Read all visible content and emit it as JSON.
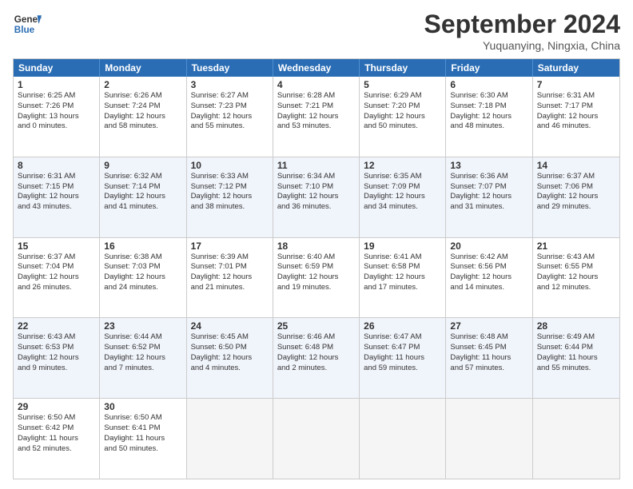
{
  "logo": {
    "line1": "General",
    "line2": "Blue"
  },
  "title": "September 2024",
  "subtitle": "Yuquanying, Ningxia, China",
  "days": [
    "Sunday",
    "Monday",
    "Tuesday",
    "Wednesday",
    "Thursday",
    "Friday",
    "Saturday"
  ],
  "weeks": [
    [
      {
        "day": "1",
        "sunrise": "Sunrise: 6:25 AM",
        "sunset": "Sunset: 7:26 PM",
        "daylight": "Daylight: 13 hours",
        "minutes": "and 0 minutes."
      },
      {
        "day": "2",
        "sunrise": "Sunrise: 6:26 AM",
        "sunset": "Sunset: 7:24 PM",
        "daylight": "Daylight: 12 hours",
        "minutes": "and 58 minutes."
      },
      {
        "day": "3",
        "sunrise": "Sunrise: 6:27 AM",
        "sunset": "Sunset: 7:23 PM",
        "daylight": "Daylight: 12 hours",
        "minutes": "and 55 minutes."
      },
      {
        "day": "4",
        "sunrise": "Sunrise: 6:28 AM",
        "sunset": "Sunset: 7:21 PM",
        "daylight": "Daylight: 12 hours",
        "minutes": "and 53 minutes."
      },
      {
        "day": "5",
        "sunrise": "Sunrise: 6:29 AM",
        "sunset": "Sunset: 7:20 PM",
        "daylight": "Daylight: 12 hours",
        "minutes": "and 50 minutes."
      },
      {
        "day": "6",
        "sunrise": "Sunrise: 6:30 AM",
        "sunset": "Sunset: 7:18 PM",
        "daylight": "Daylight: 12 hours",
        "minutes": "and 48 minutes."
      },
      {
        "day": "7",
        "sunrise": "Sunrise: 6:31 AM",
        "sunset": "Sunset: 7:17 PM",
        "daylight": "Daylight: 12 hours",
        "minutes": "and 46 minutes."
      }
    ],
    [
      {
        "day": "8",
        "sunrise": "Sunrise: 6:31 AM",
        "sunset": "Sunset: 7:15 PM",
        "daylight": "Daylight: 12 hours",
        "minutes": "and 43 minutes."
      },
      {
        "day": "9",
        "sunrise": "Sunrise: 6:32 AM",
        "sunset": "Sunset: 7:14 PM",
        "daylight": "Daylight: 12 hours",
        "minutes": "and 41 minutes."
      },
      {
        "day": "10",
        "sunrise": "Sunrise: 6:33 AM",
        "sunset": "Sunset: 7:12 PM",
        "daylight": "Daylight: 12 hours",
        "minutes": "and 38 minutes."
      },
      {
        "day": "11",
        "sunrise": "Sunrise: 6:34 AM",
        "sunset": "Sunset: 7:10 PM",
        "daylight": "Daylight: 12 hours",
        "minutes": "and 36 minutes."
      },
      {
        "day": "12",
        "sunrise": "Sunrise: 6:35 AM",
        "sunset": "Sunset: 7:09 PM",
        "daylight": "Daylight: 12 hours",
        "minutes": "and 34 minutes."
      },
      {
        "day": "13",
        "sunrise": "Sunrise: 6:36 AM",
        "sunset": "Sunset: 7:07 PM",
        "daylight": "Daylight: 12 hours",
        "minutes": "and 31 minutes."
      },
      {
        "day": "14",
        "sunrise": "Sunrise: 6:37 AM",
        "sunset": "Sunset: 7:06 PM",
        "daylight": "Daylight: 12 hours",
        "minutes": "and 29 minutes."
      }
    ],
    [
      {
        "day": "15",
        "sunrise": "Sunrise: 6:37 AM",
        "sunset": "Sunset: 7:04 PM",
        "daylight": "Daylight: 12 hours",
        "minutes": "and 26 minutes."
      },
      {
        "day": "16",
        "sunrise": "Sunrise: 6:38 AM",
        "sunset": "Sunset: 7:03 PM",
        "daylight": "Daylight: 12 hours",
        "minutes": "and 24 minutes."
      },
      {
        "day": "17",
        "sunrise": "Sunrise: 6:39 AM",
        "sunset": "Sunset: 7:01 PM",
        "daylight": "Daylight: 12 hours",
        "minutes": "and 21 minutes."
      },
      {
        "day": "18",
        "sunrise": "Sunrise: 6:40 AM",
        "sunset": "Sunset: 6:59 PM",
        "daylight": "Daylight: 12 hours",
        "minutes": "and 19 minutes."
      },
      {
        "day": "19",
        "sunrise": "Sunrise: 6:41 AM",
        "sunset": "Sunset: 6:58 PM",
        "daylight": "Daylight: 12 hours",
        "minutes": "and 17 minutes."
      },
      {
        "day": "20",
        "sunrise": "Sunrise: 6:42 AM",
        "sunset": "Sunset: 6:56 PM",
        "daylight": "Daylight: 12 hours",
        "minutes": "and 14 minutes."
      },
      {
        "day": "21",
        "sunrise": "Sunrise: 6:43 AM",
        "sunset": "Sunset: 6:55 PM",
        "daylight": "Daylight: 12 hours",
        "minutes": "and 12 minutes."
      }
    ],
    [
      {
        "day": "22",
        "sunrise": "Sunrise: 6:43 AM",
        "sunset": "Sunset: 6:53 PM",
        "daylight": "Daylight: 12 hours",
        "minutes": "and 9 minutes."
      },
      {
        "day": "23",
        "sunrise": "Sunrise: 6:44 AM",
        "sunset": "Sunset: 6:52 PM",
        "daylight": "Daylight: 12 hours",
        "minutes": "and 7 minutes."
      },
      {
        "day": "24",
        "sunrise": "Sunrise: 6:45 AM",
        "sunset": "Sunset: 6:50 PM",
        "daylight": "Daylight: 12 hours",
        "minutes": "and 4 minutes."
      },
      {
        "day": "25",
        "sunrise": "Sunrise: 6:46 AM",
        "sunset": "Sunset: 6:48 PM",
        "daylight": "Daylight: 12 hours",
        "minutes": "and 2 minutes."
      },
      {
        "day": "26",
        "sunrise": "Sunrise: 6:47 AM",
        "sunset": "Sunset: 6:47 PM",
        "daylight": "Daylight: 11 hours",
        "minutes": "and 59 minutes."
      },
      {
        "day": "27",
        "sunrise": "Sunrise: 6:48 AM",
        "sunset": "Sunset: 6:45 PM",
        "daylight": "Daylight: 11 hours",
        "minutes": "and 57 minutes."
      },
      {
        "day": "28",
        "sunrise": "Sunrise: 6:49 AM",
        "sunset": "Sunset: 6:44 PM",
        "daylight": "Daylight: 11 hours",
        "minutes": "and 55 minutes."
      }
    ],
    [
      {
        "day": "29",
        "sunrise": "Sunrise: 6:50 AM",
        "sunset": "Sunset: 6:42 PM",
        "daylight": "Daylight: 11 hours",
        "minutes": "and 52 minutes."
      },
      {
        "day": "30",
        "sunrise": "Sunrise: 6:50 AM",
        "sunset": "Sunset: 6:41 PM",
        "daylight": "Daylight: 11 hours",
        "minutes": "and 50 minutes."
      },
      {
        "day": "",
        "sunrise": "",
        "sunset": "",
        "daylight": "",
        "minutes": ""
      },
      {
        "day": "",
        "sunrise": "",
        "sunset": "",
        "daylight": "",
        "minutes": ""
      },
      {
        "day": "",
        "sunrise": "",
        "sunset": "",
        "daylight": "",
        "minutes": ""
      },
      {
        "day": "",
        "sunrise": "",
        "sunset": "",
        "daylight": "",
        "minutes": ""
      },
      {
        "day": "",
        "sunrise": "",
        "sunset": "",
        "daylight": "",
        "minutes": ""
      }
    ]
  ],
  "alt_rows": [
    1,
    3
  ]
}
